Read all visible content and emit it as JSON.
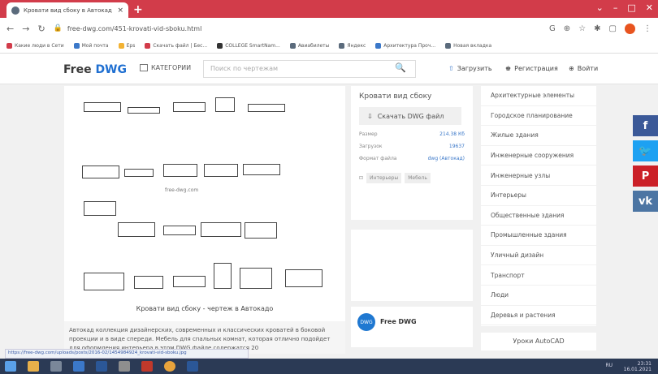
{
  "browser": {
    "tab_title": "Кровати вид сбоку в Автокад",
    "tab_close": "×",
    "new_tab": "+",
    "url": "free-dwg.com/451-krovati-vid-sboku.html",
    "window_controls": [
      "⌄",
      "–",
      "□",
      "✕"
    ]
  },
  "bookmarks": [
    {
      "label": "Какие люди в Сети",
      "color": "#d23c4a"
    },
    {
      "label": "Мой почта",
      "color": "#3b78c9"
    },
    {
      "label": "Eps",
      "color": "#f2b233"
    },
    {
      "label": "Скачать файл | Бес...",
      "color": "#d23c4a"
    },
    {
      "label": "COLLEGE SmartNam...",
      "color": "#333"
    },
    {
      "label": "Авиабилеты",
      "color": "#5b6b7c"
    },
    {
      "label": "Яндекс",
      "color": "#5b6b7c"
    },
    {
      "label": "Архитектура Проч...",
      "color": "#3b78c9"
    },
    {
      "label": "Новая вкладка",
      "color": "#5b6b7c"
    }
  ],
  "site": {
    "logo_free": "Free ",
    "logo_dwg": "DWG",
    "categories_btn": "КАТЕГОРИИ",
    "search_placeholder": "Поиск по чертежам",
    "upload": "Загрузить",
    "register": "Регистрация",
    "login": "Войти"
  },
  "main": {
    "watermark": "free-dwg.com",
    "caption": "Кровати вид сбоку - чертеж в Автокадо",
    "description": "Автокад коллекция дизайнерских, современных и классических кроватей в боковой проекции и в виде спереди. Мебель для спальных комнат, которая отлично подойдет для оформления интерьера в этом DWG файле содержатся 20"
  },
  "info": {
    "title": "Кровати вид сбоку",
    "download": "Скачать DWG файл",
    "size_label": "Размер",
    "size_value": "214.38 Кб",
    "downloads_label": "Загрузок",
    "downloads_value": "19637",
    "format_label": "Формат файла",
    "format_value": "dwg (Автокад)",
    "tag1": "Интерьеры",
    "tag2": "Мебель"
  },
  "social": {
    "name": "Free DWG",
    "logo_text": "DWG"
  },
  "categories": [
    "Архитектурные элементы",
    "Городское планирование",
    "Жилые здания",
    "Инженерные сооружения",
    "Инженерные узлы",
    "Интерьеры",
    "Общественные здания",
    "Промышленные здания",
    "Уличный дизайн",
    "Транспорт",
    "Люди",
    "Деревья и растения"
  ],
  "lessons": "Уроки AutoCAD",
  "share": [
    {
      "glyph": "f",
      "color": "#3b5998"
    },
    {
      "glyph": "🐦",
      "color": "#1da1f2"
    },
    {
      "glyph": "P",
      "color": "#cb2027"
    },
    {
      "glyph": "vk",
      "color": "#4c75a3"
    }
  ],
  "status_url": "https://free-dwg.com/uploads/posts/2016-02/1454984924_krovati-vid-sboku.jpg",
  "taskbar_time": "23:31",
  "taskbar_date": "16.01.2021",
  "taskbar_lang": "RU"
}
